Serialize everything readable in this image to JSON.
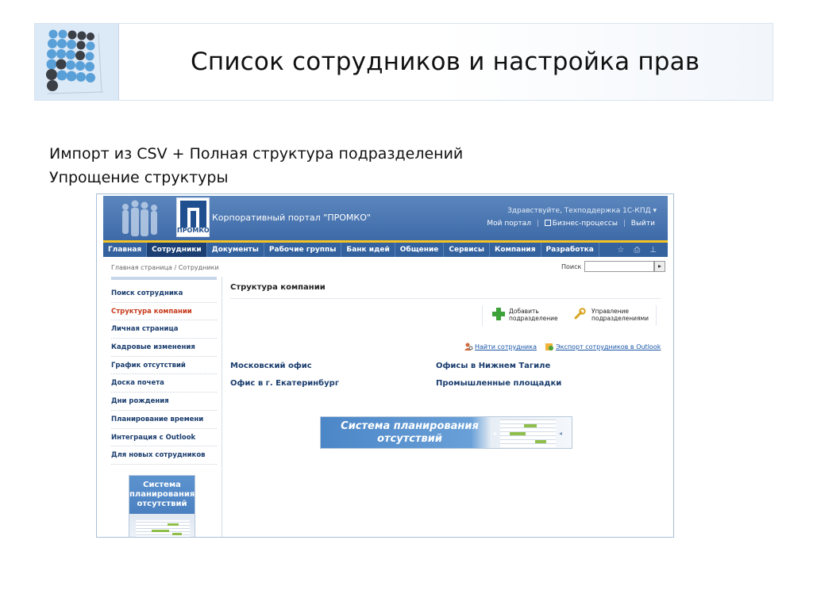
{
  "slide": {
    "title": "Список сотрудников и настройка прав",
    "subtitle_line1": "Импорт из CSV + Полная структура подразделений",
    "subtitle_line2": "Упрощение структуры"
  },
  "portal": {
    "brand_logo_text": "ПРОМКО",
    "portal_name": "Корпоративный портал \"ПРОМКО\"",
    "greeting": "Здравствуйте, Техподдержка 1С-КПД ▾",
    "top_links": {
      "my_portal": "Мой портал",
      "business_processes": "Бизнес-процессы",
      "logout": "Выйти"
    },
    "nav": [
      {
        "label": "Главная"
      },
      {
        "label": "Сотрудники",
        "active": true
      },
      {
        "label": "Документы"
      },
      {
        "label": "Рабочие группы"
      },
      {
        "label": "Банк идей"
      },
      {
        "label": "Общение"
      },
      {
        "label": "Сервисы"
      },
      {
        "label": "Компания"
      },
      {
        "label": "Разработка"
      }
    ],
    "nav_icons": [
      "star-icon",
      "print-icon",
      "sitemap-icon"
    ],
    "breadcrumb": "Главная страница / Сотрудники",
    "search": {
      "label": "Поиск",
      "value": "",
      "button": "▸"
    },
    "sidebar": [
      {
        "label": "Поиск сотрудника"
      },
      {
        "label": "Структура компании",
        "active": true
      },
      {
        "label": "Личная страница"
      },
      {
        "label": "Кадровые изменения"
      },
      {
        "label": "График отсутствий"
      },
      {
        "label": "Доска почета"
      },
      {
        "label": "Дни рождения"
      },
      {
        "label": "Планирование времени"
      },
      {
        "label": "Интеграция с Outlook"
      },
      {
        "label": "Для новых сотрудников"
      }
    ],
    "sidebar_promo": "Система планирования отсутствий",
    "main": {
      "title": "Структура компании",
      "actions": [
        {
          "line1": "Добавить",
          "line2": "подразделение",
          "icon": "plus-icon"
        },
        {
          "line1": "Управление",
          "line2": "подразделениями",
          "icon": "wrench-icon"
        }
      ],
      "links": {
        "find_employee": "Найти сотрудника",
        "export_outlook": "Экспорт сотрудников в Outlook"
      },
      "offices": [
        "Московский офис",
        "Офисы в Нижнем Тагиле",
        "Офис в г. Екатеринбург",
        "Промышленные площадки"
      ],
      "banner_line1": "Система планирования",
      "banner_line2": "отсутствий"
    },
    "colors": {
      "header_blue": "#3e6aa8",
      "nav_blue": "#34629f",
      "nav_active": "#1b3f73",
      "gold_line": "#f3c323",
      "link_blue": "#1a56a8",
      "active_red": "#c63a1b"
    }
  }
}
